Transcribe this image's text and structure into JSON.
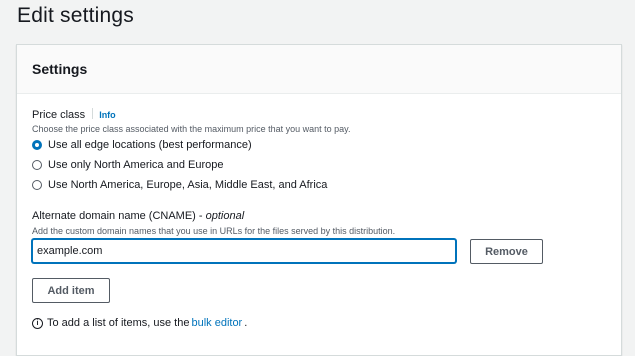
{
  "page": {
    "title": "Edit settings"
  },
  "panel": {
    "title": "Settings",
    "price_class": {
      "label": "Price class",
      "info": "Info",
      "description": "Choose the price class associated with the maximum price that you want to pay.",
      "options": [
        {
          "label": "Use all edge locations (best performance)",
          "selected": true
        },
        {
          "label": "Use only North America and Europe",
          "selected": false
        },
        {
          "label": "Use North America, Europe, Asia, Middle East, and Africa",
          "selected": false
        }
      ]
    },
    "cname": {
      "label": "Alternate domain name (CNAME)",
      "optional": "optional",
      "description": "Add the custom domain names that you use in URLs for the files served by this distribution.",
      "value": "example.com",
      "remove_label": "Remove",
      "add_label": "Add item",
      "note_prefix": "To add a list of items, use the",
      "note_link": "bulk editor",
      "note_suffix": "."
    }
  },
  "colors": {
    "accent": "#0073bb",
    "text": "#16191f",
    "secondary": "#545b64"
  },
  "icons": {
    "info": "info-circle-icon"
  }
}
